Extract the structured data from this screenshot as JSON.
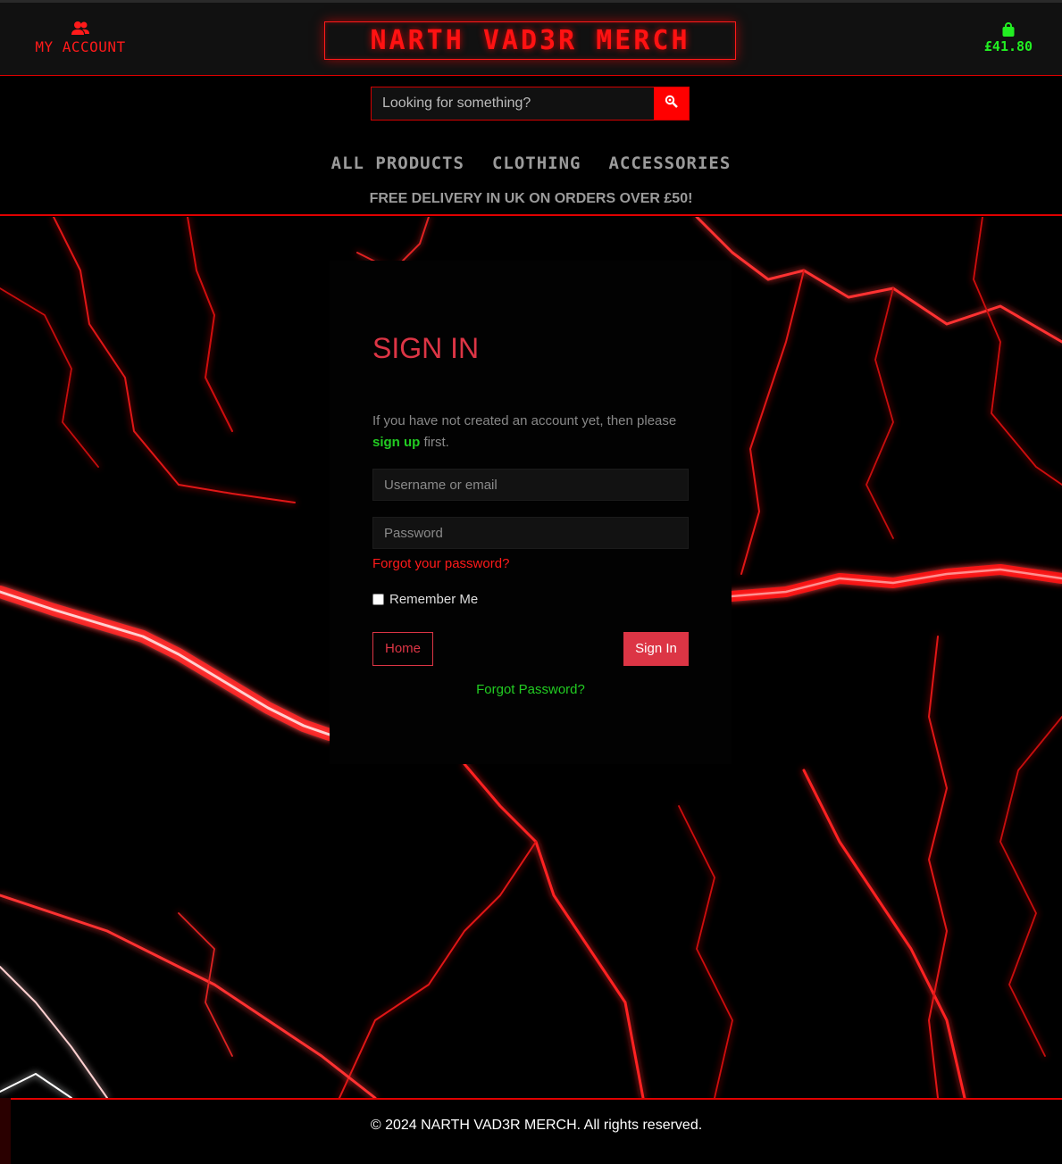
{
  "header": {
    "account_label": "MY ACCOUNT",
    "logo_text": "NARTH VAD3R MERCH",
    "cart_total": "£41.80",
    "account_icon": "users-icon",
    "cart_icon": "shopping-bag-icon"
  },
  "search": {
    "placeholder": "Looking for something?",
    "button_icon": "search-icon"
  },
  "nav": {
    "items": [
      "ALL PRODUCTS",
      "CLOTHING",
      "ACCESSORIES"
    ]
  },
  "promo": "FREE DELIVERY IN UK ON ORDERS OVER £50!",
  "signin": {
    "title": "SIGN IN",
    "intro_text": "If you have not created an account yet, then please",
    "signup_link": "sign up",
    "intro_suffix": "first.",
    "username_placeholder": "Username or email",
    "password_placeholder": "Password",
    "forgot_red": "Forgot your password?",
    "remember_label": "Remember Me",
    "home_button": "Home",
    "signin_button": "Sign In",
    "forgot_green": "Forgot Password?"
  },
  "footer": {
    "copyright": "© 2024 NARTH VAD3R MERCH. All rights reserved."
  },
  "colors": {
    "brand_red": "#ff1212",
    "accent_red": "#dc3545",
    "accent_green": "#22cc22",
    "nav_grey": "#9b9b9b"
  }
}
